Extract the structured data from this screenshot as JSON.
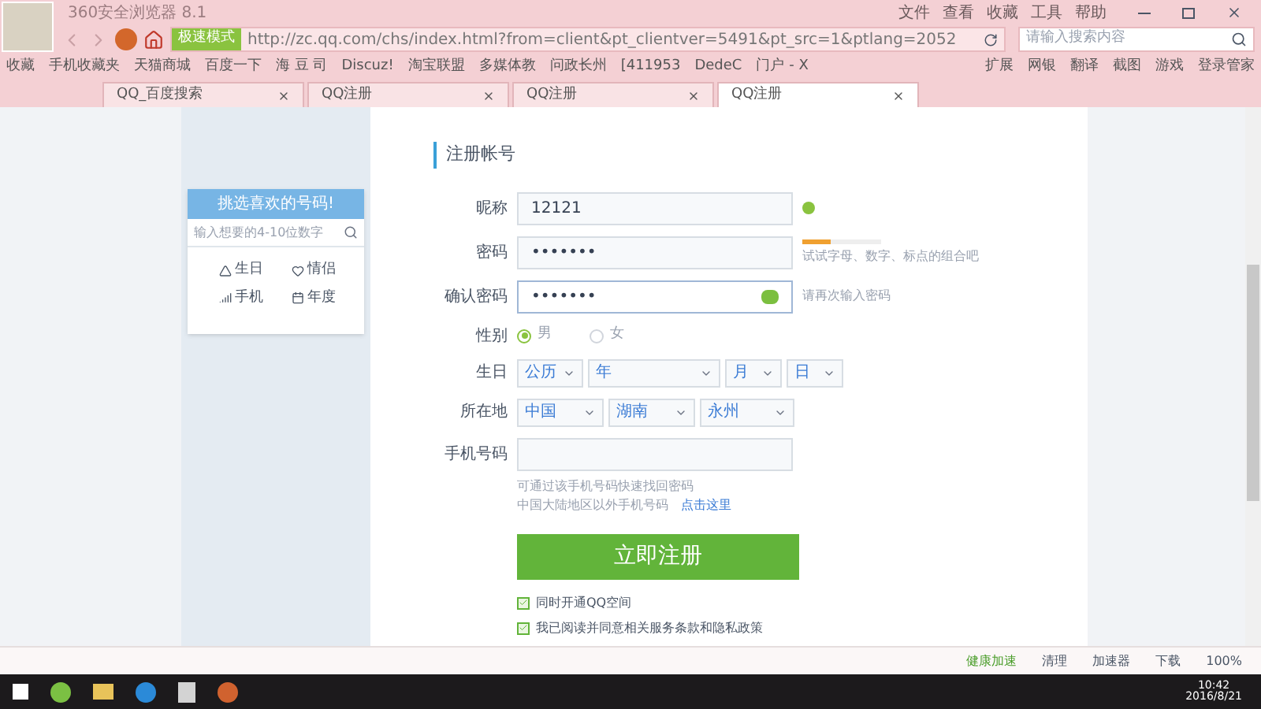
{
  "browser": {
    "title": "360安全浏览器 8.1",
    "menu": [
      "文件",
      "查看",
      "收藏",
      "工具",
      "帮助"
    ],
    "mode_badge": "极速模式",
    "url": "http://zc.qq.com/chs/index.html?from=client&pt_clientver=5491&pt_src=1&ptlang=2052",
    "search": {
      "placeholder": "请输入搜索内容"
    },
    "bookmarks": [
      "收藏",
      "手机收藏夹",
      "天猫商城",
      "百度一下",
      "海 豆 司",
      "Discuz!",
      "淘宝联盟",
      "多媒体教",
      "问政长州",
      "[411953",
      "DedeC",
      "门户 - X"
    ],
    "tools": [
      "扩展",
      "网银",
      "翻译",
      "截图",
      "游戏",
      "登录管家"
    ],
    "tabs": [
      {
        "label": "QQ_百度搜索",
        "selected": false
      },
      {
        "label": "QQ注册",
        "selected": false
      },
      {
        "label": "QQ注册",
        "selected": false
      },
      {
        "label": "QQ注册",
        "selected": true
      }
    ]
  },
  "sidebar": {
    "banner": "挑选喜欢的号码!",
    "search": {
      "placeholder": "输入想要的4-10位数字"
    },
    "options": [
      "生日",
      "情侣",
      "手机",
      "年度"
    ]
  },
  "form": {
    "title": "注册帐号",
    "nickname": {
      "label": "昵称",
      "value": "12121",
      "valid": true
    },
    "password": {
      "label": "密码",
      "value": "•••••••",
      "strength": {
        "level": 0.35
      },
      "hint": "试试字母、数字、标点的组合吧"
    },
    "confirm": {
      "label": "确认密码",
      "value": "•••••••",
      "hint": "请再次输入密码"
    },
    "gender": {
      "label": "性别",
      "options": [
        {
          "label": "男",
          "selected": true
        },
        {
          "label": "女",
          "selected": false
        }
      ]
    },
    "birthday": {
      "label": "生日",
      "selects": [
        "公历",
        "年",
        "月",
        "日"
      ]
    },
    "location": {
      "label": "所在地",
      "selects": [
        "中国",
        "湖南",
        "永州"
      ]
    },
    "phone": {
      "label": "手机号码"
    },
    "phone_note": "可通过该手机号码快速找回密码",
    "phone_note2": "中国大陆地区以外手机号码",
    "phone_link": "点击这里",
    "submit": "立即注册",
    "agreements": [
      {
        "label": "同时开通QQ空间",
        "checked": true
      },
      {
        "label": "我已阅读并同意相关服务条款和隐私政策",
        "checked": true
      }
    ]
  },
  "status_bar": {
    "items": [
      "健康加速",
      "清理",
      "加速器",
      "下载"
    ],
    "zoom": "100%"
  },
  "taskbar": {
    "time": "10:42",
    "date": "2016/8/21"
  }
}
